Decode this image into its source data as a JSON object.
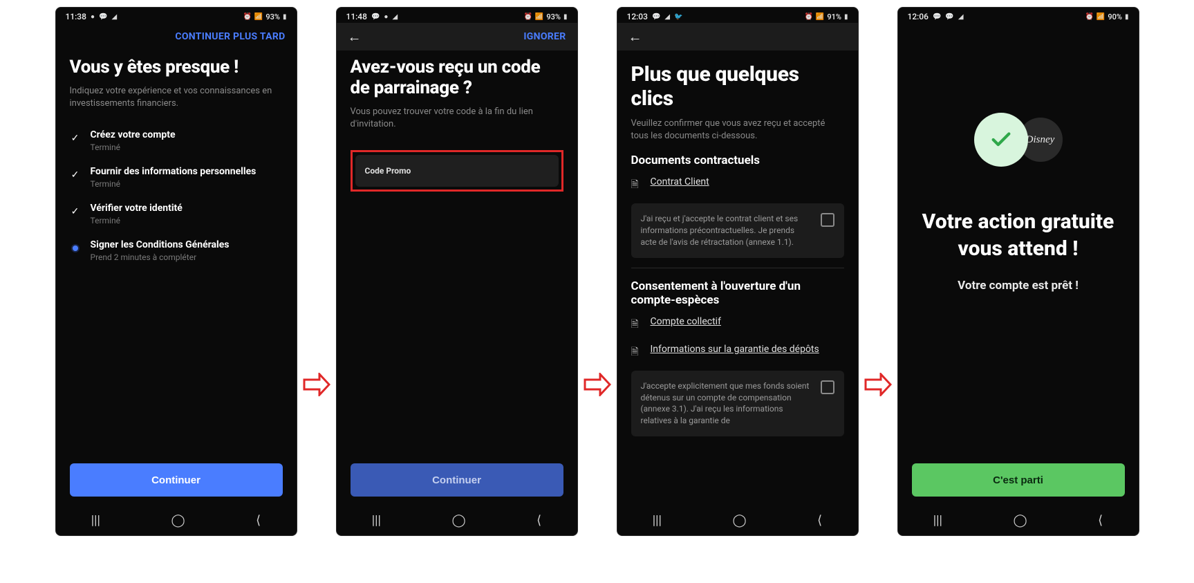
{
  "screens": [
    {
      "status": {
        "time": "11:38",
        "battery": "93%"
      },
      "skip": "CONTINUER PLUS TARD",
      "title": "Vous y êtes presque !",
      "subtitle": "Indiquez votre expérience et vos connaissances en investissements financiers.",
      "steps": [
        {
          "title": "Créez votre compte",
          "sub": "Terminé",
          "done": true
        },
        {
          "title": "Fournir des informations personnelles",
          "sub": "Terminé",
          "done": true
        },
        {
          "title": "Vérifier votre identité",
          "sub": "Terminé",
          "done": true
        },
        {
          "title": "Signer les Conditions Générales",
          "sub": "Prend 2 minutes à compléter",
          "done": false
        }
      ],
      "cta": "Continuer"
    },
    {
      "status": {
        "time": "11:48",
        "battery": "93%"
      },
      "skip": "IGNORER",
      "title": "Avez-vous reçu un code de parrainage ?",
      "subtitle": "Vous pouvez trouver votre code à la fin du lien d'invitation.",
      "promo_label": "Code Promo",
      "cta": "Continuer"
    },
    {
      "status": {
        "time": "12:03",
        "battery": "91%"
      },
      "title": "Plus que quelques clics",
      "subtitle": "Veuillez confirmer que vous avez reçu et accepté tous les documents ci-dessous.",
      "section1": "Documents contractuels",
      "doc1": "Contrat Client",
      "consent1": "J'ai reçu et j'accepte le contrat client et ses informations précontractuelles. Je prends acte de l'avis de rétractation (annexe 1.1).",
      "section2": "Consentement à l'ouverture d'un compte-espèces",
      "doc2": "Compte collectif",
      "doc3": "Informations sur la garantie des dépôts",
      "consent2": "J'accepte explicitement que mes fonds soient détenus sur un compte de compensation (annexe 3.1). J'ai reçu les informations relatives à la garantie de"
    },
    {
      "status": {
        "time": "12:06",
        "battery": "90%"
      },
      "brand_badge": "Disney",
      "title": "Votre action gratuite vous attend !",
      "subtitle": "Votre compte est prêt !",
      "cta": "C'est parti"
    }
  ],
  "nav_icons": {
    "recents": "|||",
    "home": "◯",
    "back": "⟨"
  }
}
